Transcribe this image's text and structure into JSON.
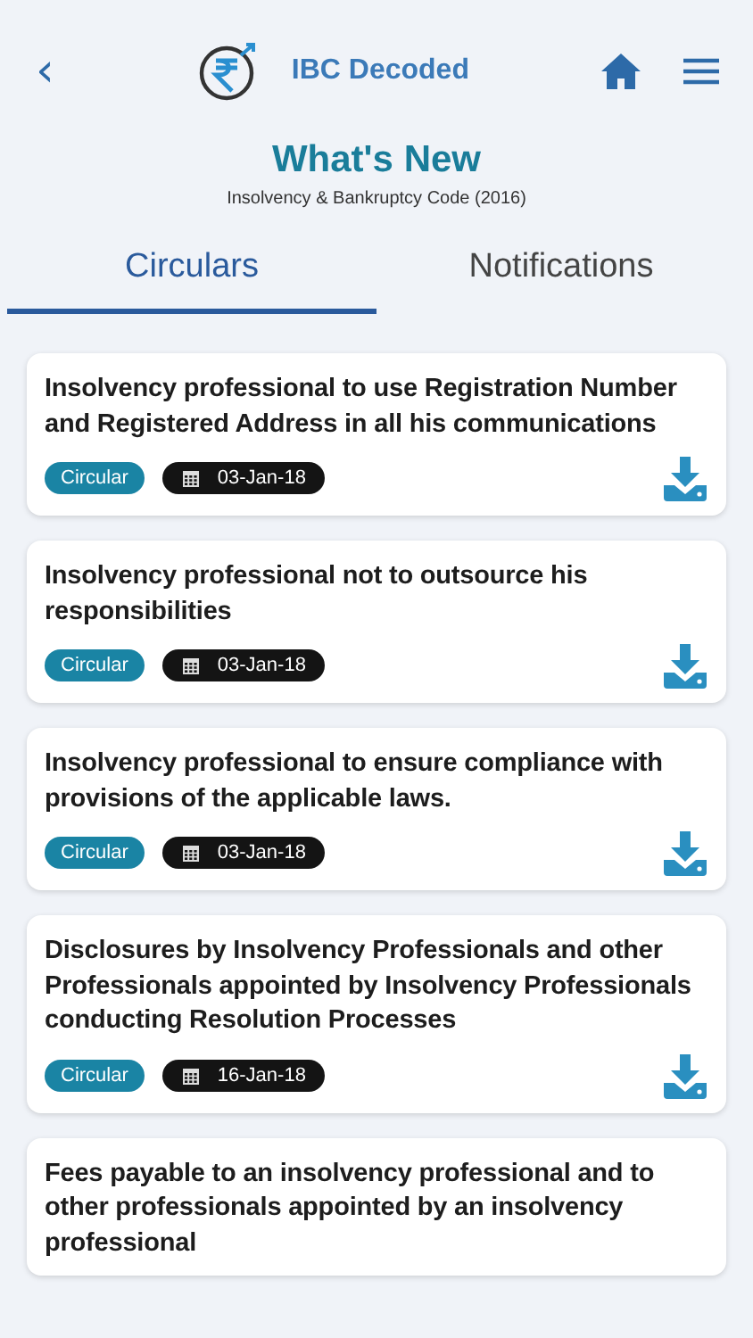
{
  "header": {
    "back": "‹",
    "app_name": "IBC Decoded"
  },
  "page": {
    "title": "What's New",
    "subtitle": "Insolvency & Bankruptcy Code (2016)"
  },
  "tabs": [
    {
      "label": "Circulars",
      "selected": true
    },
    {
      "label": "Notifications",
      "selected": false
    }
  ],
  "items": [
    {
      "title": "Insolvency professional to use Registration Number and Registered Address in all his communications",
      "tag": "Circular",
      "date": "03-Jan-18"
    },
    {
      "title": "Insolvency professional not to outsource his responsibilities",
      "tag": "Circular",
      "date": "03-Jan-18"
    },
    {
      "title": "Insolvency professional to ensure compliance with provisions of the applicable laws.",
      "tag": "Circular",
      "date": "03-Jan-18"
    },
    {
      "title": "Disclosures by Insolvency Professionals and other Professionals appointed by Insolvency Professionals conducting Resolution Processes",
      "tag": "Circular",
      "date": "16-Jan-18"
    },
    {
      "title": "Fees payable to an insolvency professional and to other professionals appointed by an insolvency professional"
    }
  ]
}
